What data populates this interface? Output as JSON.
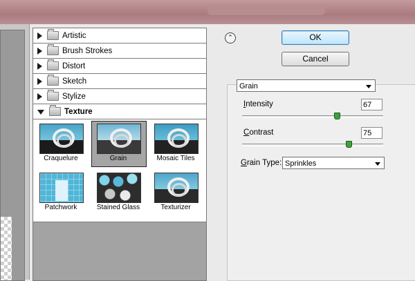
{
  "filter_categories": [
    {
      "label": "Artistic",
      "expanded": false
    },
    {
      "label": "Brush Strokes",
      "expanded": false
    },
    {
      "label": "Distort",
      "expanded": false
    },
    {
      "label": "Sketch",
      "expanded": false
    },
    {
      "label": "Stylize",
      "expanded": false
    },
    {
      "label": "Texture",
      "expanded": true
    }
  ],
  "texture_thumbnails": [
    {
      "label": "Craquelure",
      "selected": false
    },
    {
      "label": "Grain",
      "selected": true
    },
    {
      "label": "Mosaic Tiles",
      "selected": false
    },
    {
      "label": "Patchwork",
      "selected": false
    },
    {
      "label": "Stained Glass",
      "selected": false
    },
    {
      "label": "Texturizer",
      "selected": false
    }
  ],
  "buttons": {
    "ok": "OK",
    "cancel": "Cancel",
    "collapse_icon": "double-chevron-up-icon"
  },
  "settings": {
    "filter_select": "Grain",
    "intensity": {
      "label_underlined": "I",
      "label_rest": "ntensity",
      "value": "67",
      "slider_fraction": 0.67
    },
    "contrast": {
      "label_underlined": "C",
      "label_rest": "ontrast",
      "value": "75",
      "slider_fraction": 0.75
    },
    "grain_type": {
      "label_underlined": "G",
      "label_rest": "rain Type:",
      "value": "Sprinkles"
    }
  },
  "colors": {
    "slider_thumb": "#3ea13e",
    "ok_button_border": "#3c7fb1"
  }
}
